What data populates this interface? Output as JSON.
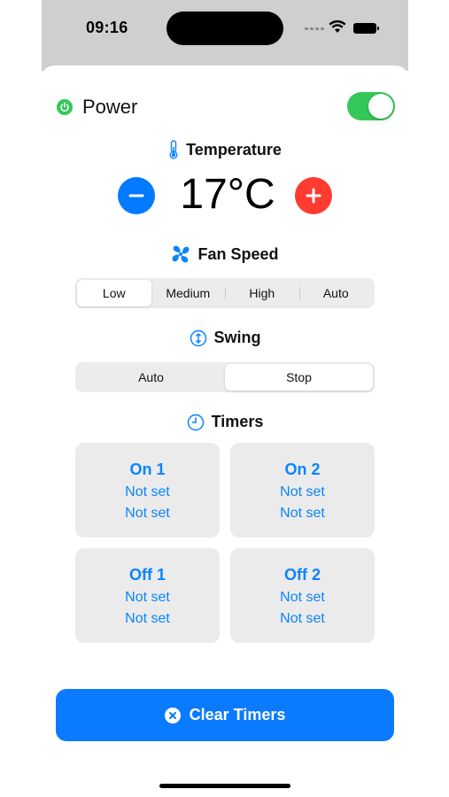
{
  "status_bar": {
    "time": "09:16"
  },
  "power": {
    "label": "Power",
    "on": true
  },
  "temperature": {
    "title": "Temperature",
    "value": "17°C"
  },
  "fan_speed": {
    "title": "Fan Speed",
    "options": [
      "Low",
      "Medium",
      "High",
      "Auto"
    ],
    "selected": "Low"
  },
  "swing": {
    "title": "Swing",
    "options": [
      "Auto",
      "Stop"
    ],
    "selected": "Stop"
  },
  "timers": {
    "title": "Timers",
    "cards": [
      {
        "title": "On 1",
        "line1": "Not set",
        "line2": "Not set"
      },
      {
        "title": "On 2",
        "line1": "Not set",
        "line2": "Not set"
      },
      {
        "title": "Off 1",
        "line1": "Not set",
        "line2": "Not set"
      },
      {
        "title": "Off 2",
        "line1": "Not set",
        "line2": "Not set"
      }
    ]
  },
  "clear_button": {
    "label": "Clear Timers"
  },
  "colors": {
    "accent": "#0a7aff",
    "toggle_on": "#34c759",
    "increase": "#ff3b30",
    "decrease": "#007aff"
  },
  "icons": {
    "power": "power-icon",
    "temperature": "thermometer-icon",
    "fan": "fan-icon",
    "swing": "swing-icon",
    "timers": "clock-icon",
    "clear": "close-circle-icon"
  }
}
